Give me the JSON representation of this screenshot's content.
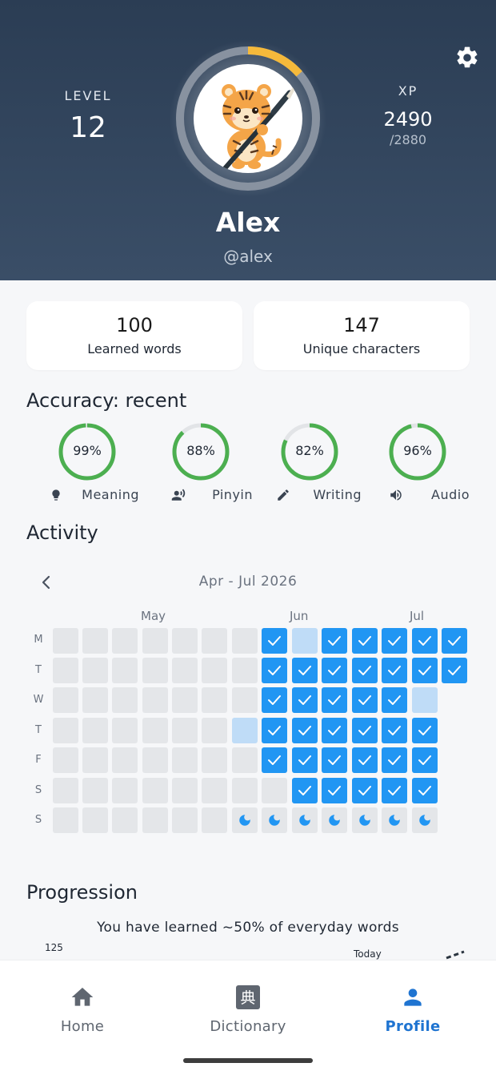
{
  "profile": {
    "level_label": "LEVEL",
    "level": "12",
    "xp_label": "XP",
    "xp": "2490",
    "xp_max": "/2880",
    "xp_progress": 0.864,
    "name": "Alex",
    "handle": "@alex",
    "settings_icon": "gear-icon",
    "avatar": "tiger-with-brush-illustration"
  },
  "stats": [
    {
      "value": "100",
      "label": "Learned words"
    },
    {
      "value": "147",
      "label": "Unique characters"
    }
  ],
  "accuracy": {
    "title": "Accuracy: recent",
    "items": [
      {
        "pct": "99%",
        "value": 0.99,
        "label": "Meaning",
        "icon": "lightbulb-icon"
      },
      {
        "pct": "88%",
        "value": 0.88,
        "label": "Pinyin",
        "icon": "speaking-person-icon"
      },
      {
        "pct": "82%",
        "value": 0.82,
        "label": "Writing",
        "icon": "pencil-icon"
      },
      {
        "pct": "96%",
        "value": 0.96,
        "label": "Audio",
        "icon": "speaker-icon"
      }
    ],
    "ring_color": "#4caf50",
    "track_color": "#e2e4e7"
  },
  "activity": {
    "title": "Activity",
    "range": "Apr - Jul 2026",
    "months": [
      "May",
      "Jun",
      "Jul"
    ],
    "days": [
      "M",
      "T",
      "W",
      "T",
      "F",
      "S",
      "S"
    ],
    "legend": "e = empty, d = done, p = partial, r = rest day",
    "weeks": [
      "eeeeeee",
      "eeeeeee",
      "eeeeeee",
      "eeeeeee",
      "eeeeeee",
      "eeeeeee",
      "eeepeer",
      "ddddder",
      "pddddddr",
      "ddddddr",
      "ddddddr",
      "ddddddr",
      "ddddddr",
      "ddp"
    ],
    "done_color": "#2196f3",
    "partial_color": "#bfdcf7",
    "empty_color": "#e4e6e9"
  },
  "progression": {
    "title": "Progression",
    "subtitle": "You have learned ~50% of everyday words",
    "y_tick": "125",
    "today_label": "Today"
  },
  "nav": [
    {
      "label": "Home",
      "icon": "home-icon",
      "active": false
    },
    {
      "label": "Dictionary",
      "icon": "dictionary-icon",
      "glyph": "典",
      "active": false
    },
    {
      "label": "Profile",
      "icon": "person-icon",
      "active": true
    }
  ]
}
